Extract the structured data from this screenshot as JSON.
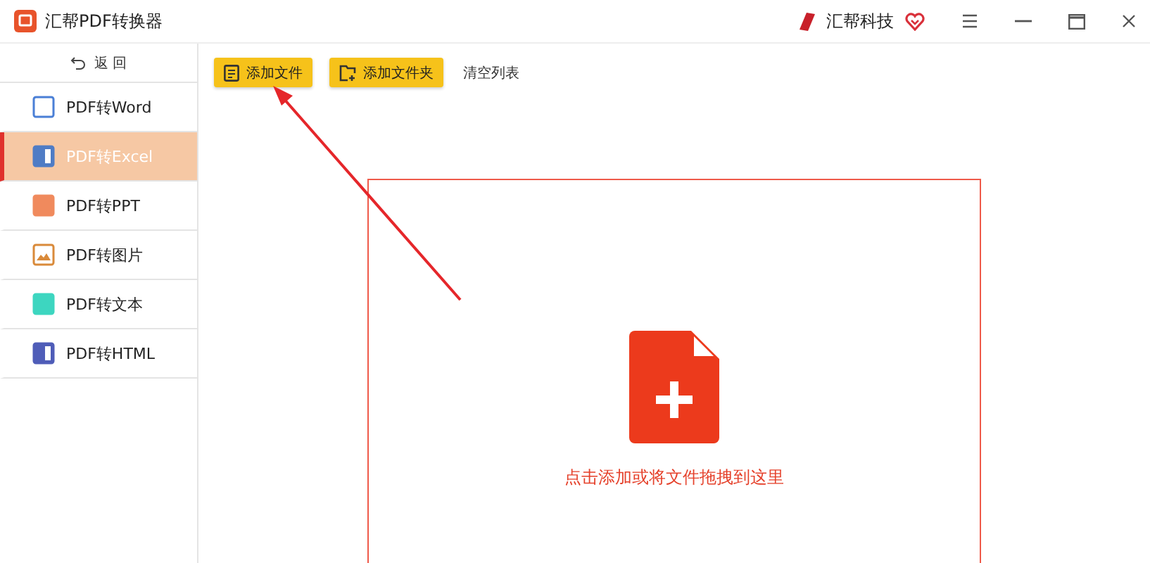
{
  "window": {
    "title": "汇帮PDF转换器",
    "brand": "汇帮科技"
  },
  "sidebar": {
    "back": "返 回",
    "items": [
      {
        "label": "PDF转Word",
        "kind": "word",
        "selected": false
      },
      {
        "label": "PDF转Excel",
        "kind": "excel",
        "selected": true
      },
      {
        "label": "PDF转PPT",
        "kind": "ppt",
        "selected": false
      },
      {
        "label": "PDF转图片",
        "kind": "image",
        "selected": false
      },
      {
        "label": "PDF转文本",
        "kind": "text",
        "selected": false
      },
      {
        "label": "PDF转HTML",
        "kind": "html",
        "selected": false
      }
    ]
  },
  "toolbar": {
    "buttons": [
      {
        "label": "添加文件",
        "kind": "file"
      },
      {
        "label": "添加文件夹",
        "kind": "folder"
      }
    ],
    "clear": "清空列表"
  },
  "dropzone": {
    "hint": "点击添加或将文件拖拽到这里"
  }
}
